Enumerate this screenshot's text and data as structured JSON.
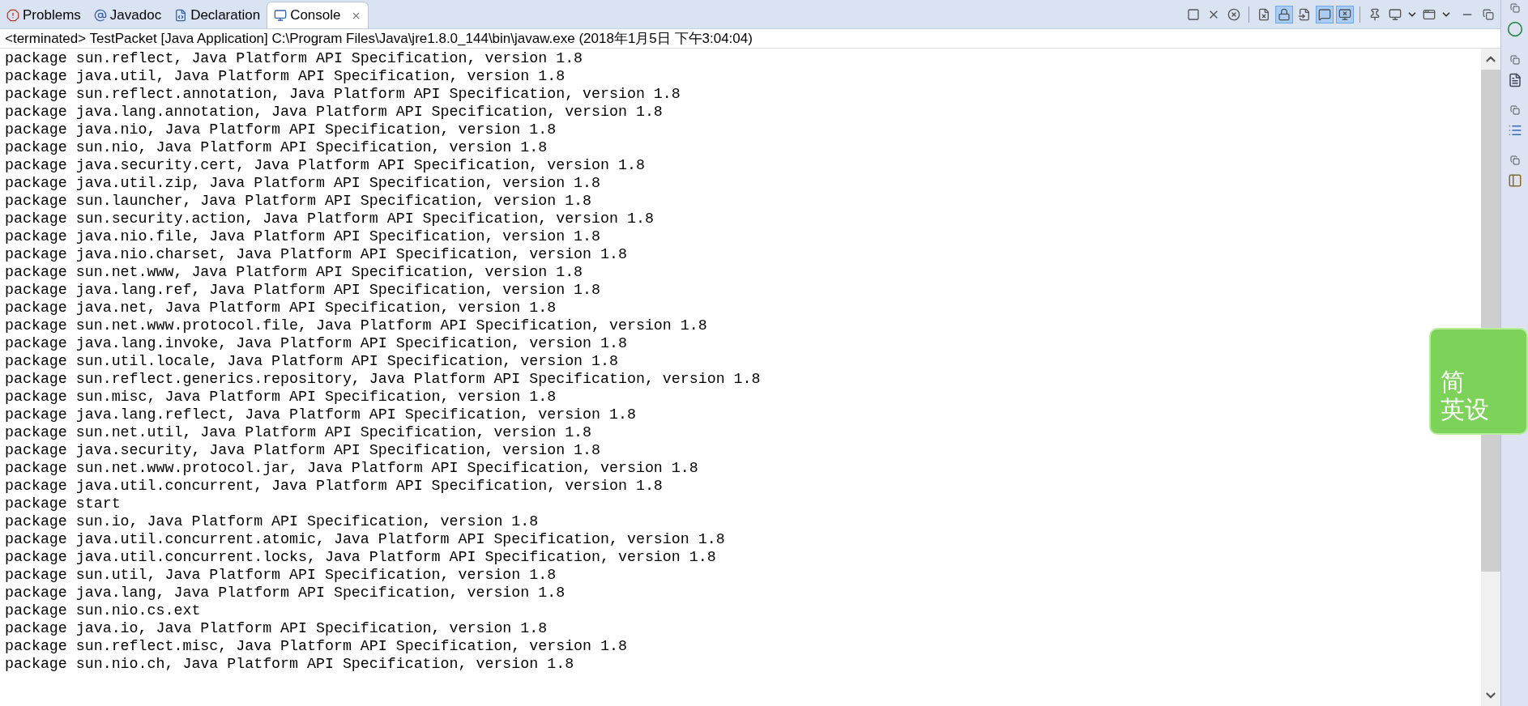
{
  "tabs": [
    {
      "label": "Problems",
      "selected": false
    },
    {
      "label": "Javadoc",
      "selected": false
    },
    {
      "label": "Declaration",
      "selected": false
    },
    {
      "label": "Console",
      "selected": true,
      "closable": true
    }
  ],
  "toolbar": [
    {
      "kind": "button",
      "pressed": false
    },
    {
      "kind": "button",
      "pressed": false
    },
    {
      "kind": "button",
      "pressed": false
    },
    {
      "kind": "separator"
    },
    {
      "kind": "button",
      "pressed": false
    },
    {
      "kind": "button",
      "pressed": true
    },
    {
      "kind": "button",
      "pressed": false
    },
    {
      "kind": "button",
      "pressed": true
    },
    {
      "kind": "button",
      "pressed": true
    },
    {
      "kind": "separator"
    },
    {
      "kind": "button",
      "pressed": false
    },
    {
      "kind": "button",
      "pressed": false
    },
    {
      "kind": "dropdown"
    },
    {
      "kind": "button",
      "pressed": false
    },
    {
      "kind": "dropdown"
    }
  ],
  "console": {
    "title": "<terminated> TestPacket [Java Application] C:\\Program Files\\Java\\jre1.8.0_144\\bin\\javaw.exe (2018年1月5日 下午3:04:04)",
    "lines": [
      "package sun.reflect, Java Platform API Specification, version 1.8",
      "package java.util, Java Platform API Specification, version 1.8",
      "package sun.reflect.annotation, Java Platform API Specification, version 1.8",
      "package java.lang.annotation, Java Platform API Specification, version 1.8",
      "package java.nio, Java Platform API Specification, version 1.8",
      "package sun.nio, Java Platform API Specification, version 1.8",
      "package java.security.cert, Java Platform API Specification, version 1.8",
      "package java.util.zip, Java Platform API Specification, version 1.8",
      "package sun.launcher, Java Platform API Specification, version 1.8",
      "package sun.security.action, Java Platform API Specification, version 1.8",
      "package java.nio.file, Java Platform API Specification, version 1.8",
      "package java.nio.charset, Java Platform API Specification, version 1.8",
      "package sun.net.www, Java Platform API Specification, version 1.8",
      "package java.lang.ref, Java Platform API Specification, version 1.8",
      "package java.net, Java Platform API Specification, version 1.8",
      "package sun.net.www.protocol.file, Java Platform API Specification, version 1.8",
      "package java.lang.invoke, Java Platform API Specification, version 1.8",
      "package sun.util.locale, Java Platform API Specification, version 1.8",
      "package sun.reflect.generics.repository, Java Platform API Specification, version 1.8",
      "package sun.misc, Java Platform API Specification, version 1.8",
      "package java.lang.reflect, Java Platform API Specification, version 1.8",
      "package sun.net.util, Java Platform API Specification, version 1.8",
      "package java.security, Java Platform API Specification, version 1.8",
      "package sun.net.www.protocol.jar, Java Platform API Specification, version 1.8",
      "package java.util.concurrent, Java Platform API Specification, version 1.8",
      "package start",
      "package sun.io, Java Platform API Specification, version 1.8",
      "package java.util.concurrent.atomic, Java Platform API Specification, version 1.8",
      "package java.util.concurrent.locks, Java Platform API Specification, version 1.8",
      "package sun.util, Java Platform API Specification, version 1.8",
      "package java.lang, Java Platform API Specification, version 1.8",
      "package sun.nio.cs.ext",
      "package java.io, Java Platform API Specification, version 1.8",
      "package sun.reflect.misc, Java Platform API Specification, version 1.8",
      "package sun.nio.ch, Java Platform API Specification, version 1.8"
    ]
  },
  "ime": {
    "labels": [
      "简",
      "英设"
    ]
  }
}
